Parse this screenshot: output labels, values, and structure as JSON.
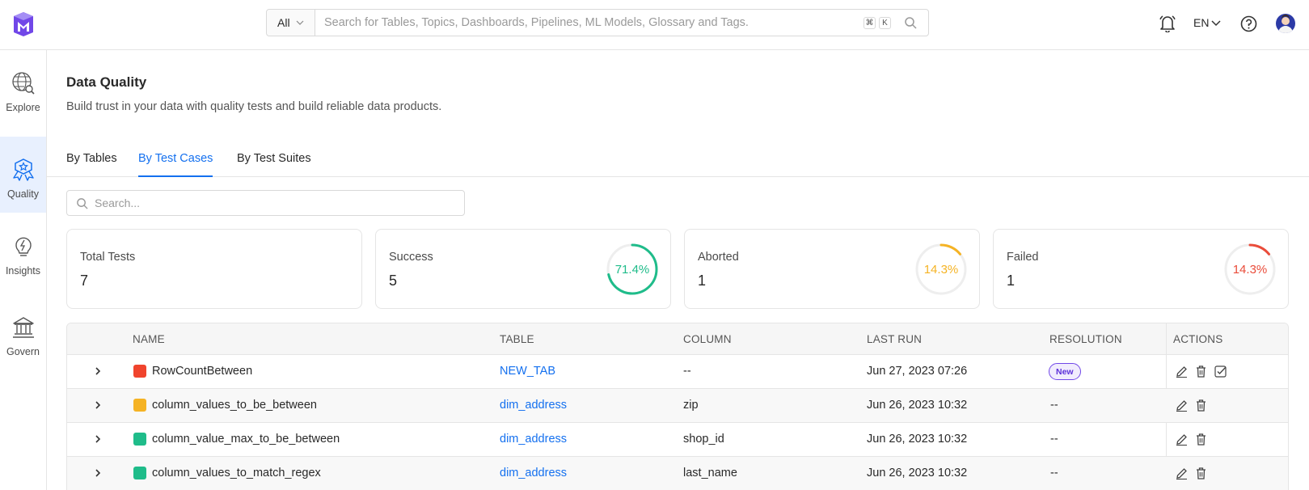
{
  "header": {
    "search_category": "All",
    "search_placeholder": "Search for Tables, Topics, Dashboards, Pipelines, ML Models, Glossary and Tags.",
    "shortcut_keys": [
      "⌘",
      "K"
    ],
    "language": "EN",
    "brand_color": "#7147e8"
  },
  "sidebar": {
    "items": [
      {
        "label": "Explore",
        "icon": "explore-icon",
        "active": false
      },
      {
        "label": "Quality",
        "icon": "quality-icon",
        "active": true
      },
      {
        "label": "Insights",
        "icon": "insights-icon",
        "active": false
      },
      {
        "label": "Govern",
        "icon": "govern-icon",
        "active": false
      }
    ]
  },
  "page": {
    "title": "Data Quality",
    "subtitle": "Build trust in your data with quality tests and build reliable data products."
  },
  "tabs": [
    {
      "label": "By Tables",
      "active": false
    },
    {
      "label": "By Test Cases",
      "active": true
    },
    {
      "label": "By Test Suites",
      "active": false
    }
  ],
  "filter": {
    "placeholder": "Search..."
  },
  "summary": {
    "total": {
      "label": "Total Tests",
      "value": "7"
    },
    "success": {
      "label": "Success",
      "value": "5",
      "percent": "71.4%",
      "fraction": 0.714,
      "color": "#1fbc8a"
    },
    "aborted": {
      "label": "Aborted",
      "value": "1",
      "percent": "14.3%",
      "fraction": 0.143,
      "color": "#f5b324"
    },
    "failed": {
      "label": "Failed",
      "value": "1",
      "percent": "14.3%",
      "fraction": 0.143,
      "color": "#ea4c3a"
    }
  },
  "table": {
    "columns": [
      "NAME",
      "TABLE",
      "COLUMN",
      "LAST RUN",
      "RESOLUTION",
      "ACTIONS"
    ],
    "rows": [
      {
        "status": "failed",
        "status_color": "#f0442d",
        "name": "RowCountBetween",
        "table": "NEW_TAB",
        "column": "--",
        "last_run": "Jun 27, 2023 07:26",
        "resolution": "New",
        "resolution_badge": true
      },
      {
        "status": "aborted",
        "status_color": "#f5b324",
        "name": "column_values_to_be_between",
        "table": "dim_address",
        "column": "zip",
        "last_run": "Jun 26, 2023 10:32",
        "resolution": "--",
        "resolution_badge": false
      },
      {
        "status": "success",
        "status_color": "#1fbc8a",
        "name": "column_value_max_to_be_between",
        "table": "dim_address",
        "column": "shop_id",
        "last_run": "Jun 26, 2023 10:32",
        "resolution": "--",
        "resolution_badge": false
      },
      {
        "status": "success",
        "status_color": "#1fbc8a",
        "name": "column_values_to_match_regex",
        "table": "dim_address",
        "column": "last_name",
        "last_run": "Jun 26, 2023 10:32",
        "resolution": "--",
        "resolution_badge": false
      }
    ]
  }
}
